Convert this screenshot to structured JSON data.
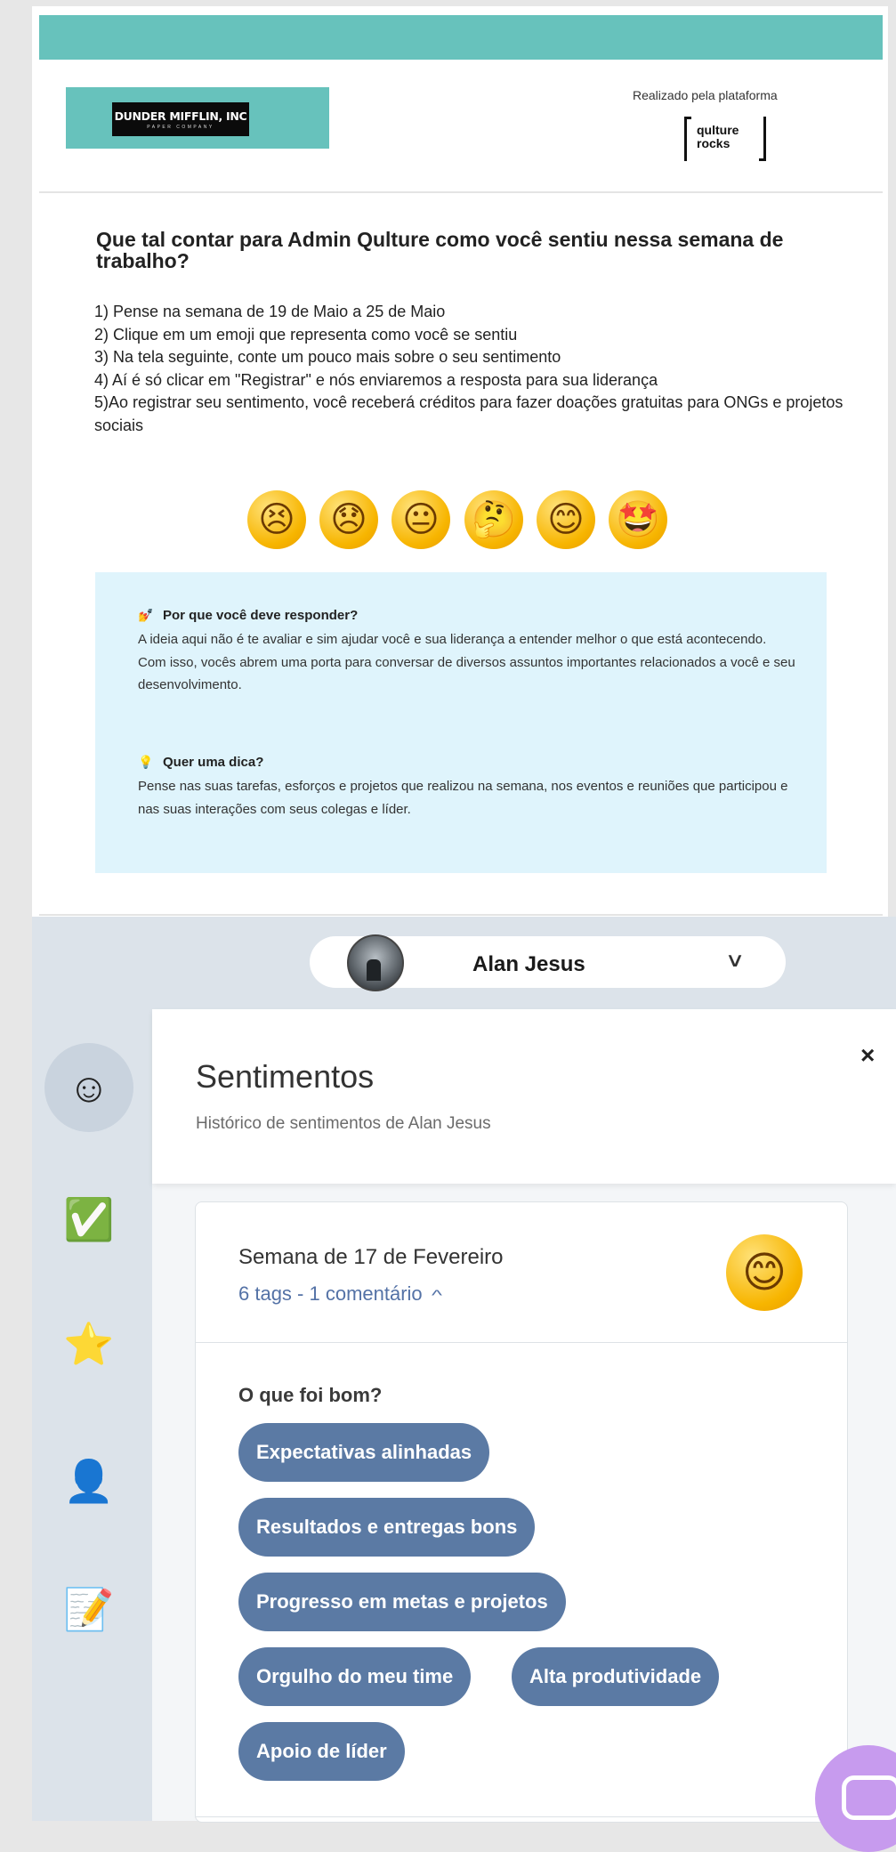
{
  "email": {
    "brand": {
      "name": "DUNDER MIFFLIN, INC",
      "tagline": "PAPER COMPANY"
    },
    "platform_label": "Realizado pela plataforma",
    "platform_logo": "qulture rocks",
    "headline": "Que tal contar para Admin Qulture como você sentiu nessa semana de trabalho?",
    "steps": [
      "1) Pense na semana de 19 de Maio a 25 de Maio",
      "2) Clique em um emoji que representa como você se sentiu",
      "3) Na tela seguinte, conte um pouco mais sobre o seu sentimento",
      "4) Aí é só clicar em \"Registrar\" e nós enviaremos a resposta para sua liderança",
      "5)Ao registrar seu sentimento, você receberá créditos para fazer doações gratuitas para ONGs e projetos sociais"
    ],
    "emoji_options": [
      "😣",
      "😞",
      "😐",
      "🤔",
      "😊",
      "🤩"
    ],
    "why": {
      "icon": "💅",
      "title": "Por que você deve responder?",
      "text": "A ideia aqui não é te avaliar e sim ajudar você e sua liderança a entender melhor o que está acontecendo. Com isso, vocês abrem uma porta para conversar de diversos assuntos importantes relacionados a você e seu desenvolvimento."
    },
    "tip": {
      "icon": "💡",
      "title": "Quer uma dica?",
      "text": "Pense nas suas tarefas, esforços e projetos que realizou na semana, nos eventos e reuniões que participou e nas suas interações com seus colegas e líder."
    }
  },
  "app": {
    "user_name": "Alan Jesus",
    "sidebar": [
      {
        "icon": "smiling-face-icon",
        "glyph": "☺",
        "active": true
      },
      {
        "icon": "check-mark-icon",
        "glyph": "✅",
        "active": false
      },
      {
        "icon": "star-icon",
        "glyph": "⭐",
        "active": false
      },
      {
        "icon": "person-icon",
        "glyph": "👤",
        "active": false
      },
      {
        "icon": "notepad-icon",
        "glyph": "📝",
        "active": false
      }
    ],
    "panel": {
      "title": "Sentimentos",
      "subtitle": "Histórico de sentimentos de Alan Jesus",
      "close_glyph": "×"
    },
    "week": {
      "title": "Semana de 17 de Fevereiro",
      "meta": "6 tags - 1 comentário",
      "emoji": "😊",
      "good_title": "O que foi bom?",
      "tags": [
        "Expectativas alinhadas",
        "Resultados e entregas bons",
        "Progresso em metas e projetos",
        "Orgulho do meu time",
        "Alta produtividade",
        "Apoio de líder"
      ]
    }
  },
  "colors": {
    "teal": "#67c2bc",
    "tag_blue": "#5b7aa4",
    "link_blue": "#5472a6",
    "info_bg": "#dff4fc",
    "chat_purple": "#c79bee"
  }
}
